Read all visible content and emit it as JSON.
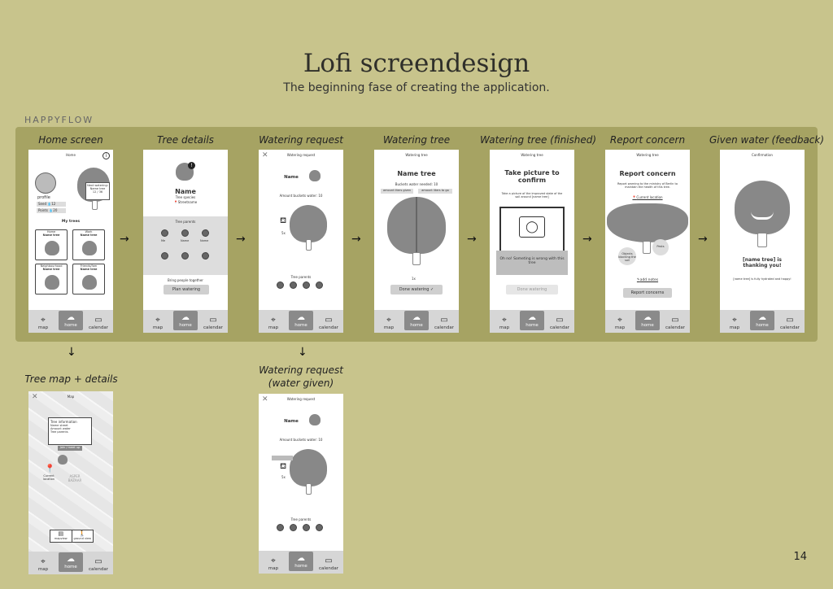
{
  "header": {
    "title": "Lofi screendesign",
    "subtitle": "The beginning fase of creating the application.",
    "section": "HAPPYFLOW",
    "page": "14"
  },
  "labels": {
    "home": "Home screen",
    "details": "Tree details",
    "request": "Watering request",
    "watering": "Watering tree",
    "finished": "Watering tree (finished)",
    "concern": "Report concern",
    "feedback": "Given water (feedback)",
    "map": "Tree map + details",
    "given": "Watering request\n(water given)"
  },
  "nav": {
    "map": "map",
    "home": "home",
    "calendar": "calendar"
  },
  "home_screen": {
    "header": "Home",
    "profile": "profile",
    "stat1": "Seed",
    "stat1_val": "12",
    "stat2": "Points",
    "stat2_val": "20",
    "next": "Next watering:",
    "next_name": "Name tree",
    "next_val": "12 / 36",
    "my_trees": "My trees",
    "card1": "Home",
    "card2": "Work",
    "card3": "Neighbourhood",
    "card4": "Friends/fam",
    "card_name": "Name tree"
  },
  "tree_details": {
    "name": "Name",
    "species": "Tree species",
    "location": "Streetname",
    "parents": "Tree parents",
    "me": "Me",
    "bring": "Bring people together",
    "plan": "Plan watering"
  },
  "request": {
    "header": "Watering request",
    "name": "Name",
    "buckets": "Amount buckets water: 10",
    "count": "5x",
    "parents": "Tree parents"
  },
  "watering": {
    "header": "Watering tree",
    "name": "Name tree",
    "needed": "Buckets water needed: 10",
    "given": "amount liters given",
    "togo": "amount liters to go",
    "count": "1x",
    "done": "Done watering"
  },
  "finished": {
    "header": "Watering tree",
    "title": "Take picture to confirm",
    "desc": "Take a picture of the improved state of the soil around [name tree]",
    "error": "Oh no! Someting is wrong with this tree",
    "done": "Done watering"
  },
  "concern": {
    "header": "Watering tree",
    "title": "Report concern",
    "desc": "Report warning to the ministry of Berlin to maintain the health of this tree.",
    "loc": "Current location",
    "b1": "Objects blocking the soil",
    "b2": "Pests",
    "notes": "add notes",
    "btn": "Report concerns"
  },
  "feedback": {
    "header": "Confirmation",
    "msg": "[name tree] is thanking you!",
    "sub": "[name tree] is fully hydrated and happy!"
  },
  "map_screen": {
    "header": "Map",
    "info": "Tree information",
    "r1": "Name street",
    "r2": "Amount water",
    "r3": "Tree parents",
    "join": "Join / meet up",
    "loc": "Current location",
    "area": "ASPER BAZAAR",
    "mapview": "mapview",
    "ground": "ground view"
  }
}
